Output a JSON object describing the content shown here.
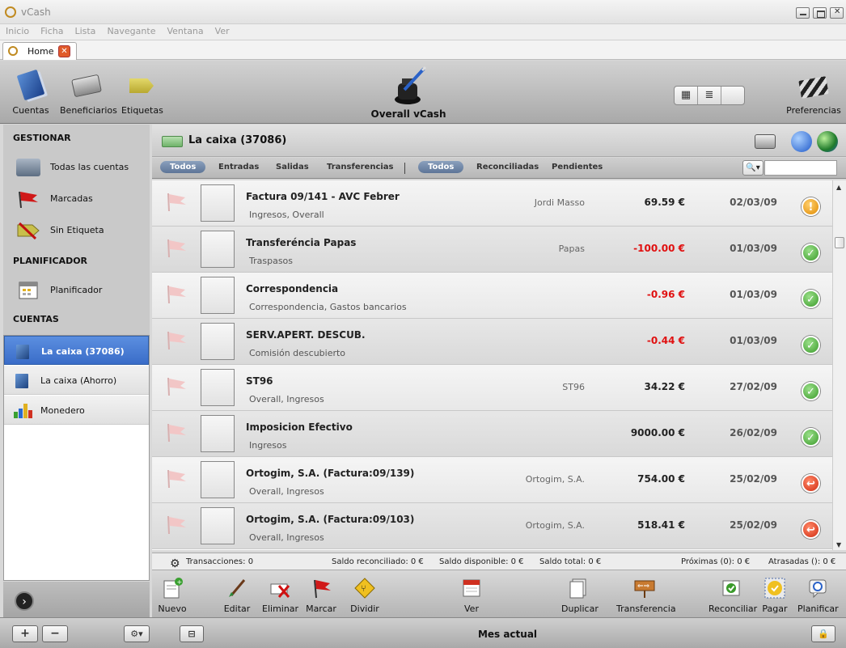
{
  "window": {
    "title": "vCash"
  },
  "menu": [
    "Inicio",
    "Ficha",
    "Lista",
    "Navegante",
    "Ventana",
    "Ver"
  ],
  "tab": {
    "label": "Home",
    "close_icon": "close-icon"
  },
  "toolbar": {
    "cuentas": "Cuentas",
    "beneficiarios": "Beneficiarios",
    "etiquetas": "Etiquetas",
    "overall": "Overall vCash",
    "preferencias": "Preferencias",
    "view_modes": [
      "▦",
      "≣",
      "☰"
    ]
  },
  "sidebar": {
    "gestionar": "GESTIONAR",
    "todas": "Todas las cuentas",
    "marcadas": "Marcadas",
    "sin_etiqueta": "Sin Etiqueta",
    "planificador_head": "PLANIFICADOR",
    "planificador": "Planificador",
    "cuentas_head": "CUENTAS",
    "accounts": [
      {
        "label": "La caixa (37086)"
      },
      {
        "label": "La caixa (Ahorro)"
      },
      {
        "label": "Monedero"
      }
    ]
  },
  "account_header": {
    "title": "La caixa (37086)"
  },
  "filters": {
    "group1": [
      "Todos",
      "Entradas",
      "Salidas",
      "Transferencias"
    ],
    "group2": [
      "Todos",
      "Reconciliadas",
      "Pendientes"
    ]
  },
  "transactions": [
    {
      "name": "Factura 09/141 - AVC Febrer",
      "cat": "Ingresos, Overall",
      "payee": "Jordi Masso",
      "amount": "69.59 €",
      "date": "02/03/09",
      "status": "!"
    },
    {
      "name": "Transferéncia Papas",
      "cat": "Traspasos",
      "payee": "Papas",
      "amount": "-100.00 €",
      "date": "01/03/09",
      "status": "✓"
    },
    {
      "name": "Correspondencia",
      "cat": "Correspondencia, Gastos bancarios",
      "payee": "",
      "amount": "-0.96 €",
      "date": "01/03/09",
      "status": "✓"
    },
    {
      "name": "SERV.APERT. DESCUB.",
      "cat": "Comisión descubierto",
      "payee": "",
      "amount": "-0.44 €",
      "date": "01/03/09",
      "status": "✓"
    },
    {
      "name": "ST96",
      "cat": "Overall, Ingresos",
      "payee": "ST96",
      "amount": "34.22 €",
      "date": "27/02/09",
      "status": "✓"
    },
    {
      "name": "Imposicion Efectivo",
      "cat": "Ingresos",
      "payee": "",
      "amount": "9000.00 €",
      "date": "26/02/09",
      "status": "✓"
    },
    {
      "name": "Ortogim, S.A. (Factura:09/139)",
      "cat": "Overall, Ingresos",
      "payee": "Ortogim, S.A.",
      "amount": "754.00 €",
      "date": "25/02/09",
      "status": "↩"
    },
    {
      "name": "Ortogim, S.A. (Factura:09/103)",
      "cat": "Overall, Ingresos",
      "payee": "Ortogim, S.A.",
      "amount": "518.41 €",
      "date": "25/02/09",
      "status": "↩"
    }
  ],
  "totals": {
    "transacciones": "Transacciones: 0",
    "reconciliado": "Saldo reconciliado:  0 €",
    "disponible": "Saldo disponible:  0 €",
    "total": "Saldo total:  0 €",
    "proximas": "Próximas (0):  0 €",
    "atrasadas": "Atrasadas ():  0 €"
  },
  "actions": {
    "nuevo": "Nuevo",
    "editar": "Editar",
    "eliminar": "Eliminar",
    "marcar": "Marcar",
    "dividir": "Dividir",
    "ver": "Ver",
    "duplicar": "Duplicar",
    "transferencia": "Transferencia",
    "reconciliar": "Reconciliar",
    "pagar": "Pagar",
    "planificar": "Planificar"
  },
  "bottom": {
    "add": "+",
    "remove": "−",
    "gear": "⚙▾",
    "period": "Mes actual"
  }
}
